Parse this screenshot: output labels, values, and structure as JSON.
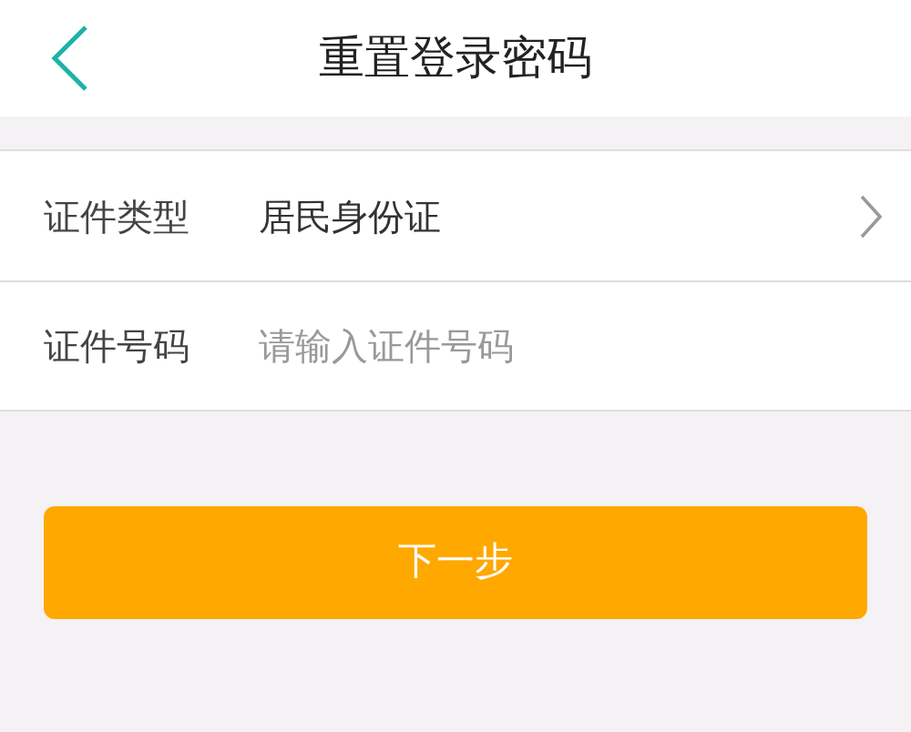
{
  "header": {
    "title": "重置登录密码"
  },
  "form": [
    {
      "kind": "select",
      "label": "证件类型",
      "value": "居民身份证"
    },
    {
      "kind": "input",
      "label": "证件号码",
      "placeholder": "请输入证件号码"
    }
  ],
  "button": {
    "label": "下一步"
  }
}
